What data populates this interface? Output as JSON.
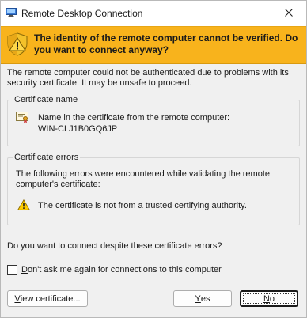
{
  "window": {
    "title": "Remote Desktop Connection",
    "close_icon": "close-icon",
    "app_icon": "remote-desktop-icon"
  },
  "banner": {
    "icon": "security-shield-warning-icon",
    "text": "The identity of the remote computer cannot be verified. Do you want to connect anyway?",
    "color": "#f8b31c"
  },
  "intro": {
    "text": "The remote computer could not be authenticated due to problems with its security certificate. It may be unsafe to proceed."
  },
  "certificate_name": {
    "legend": "Certificate name",
    "icon": "certificate-icon",
    "label": "Name in the certificate from the remote computer:",
    "value": "WIN-CLJ1B0GQ6JP"
  },
  "certificate_errors": {
    "legend": "Certificate errors",
    "intro": "The following errors were encountered while validating the remote computer's certificate:",
    "items": [
      {
        "icon": "warning-triangle-icon",
        "text": "The certificate is not from a trusted certifying authority."
      }
    ]
  },
  "question": {
    "text": "Do you want to connect despite these certificate errors?"
  },
  "dont_ask": {
    "mnemonic": "D",
    "label_rest": "on't ask me again for connections to this computer",
    "checked": false
  },
  "buttons": {
    "view_certificate": {
      "mnemonic": "V",
      "rest": "iew certificate..."
    },
    "yes": {
      "mnemonic": "Y",
      "rest": "es"
    },
    "no": {
      "mnemonic": "N",
      "rest": "o"
    }
  }
}
